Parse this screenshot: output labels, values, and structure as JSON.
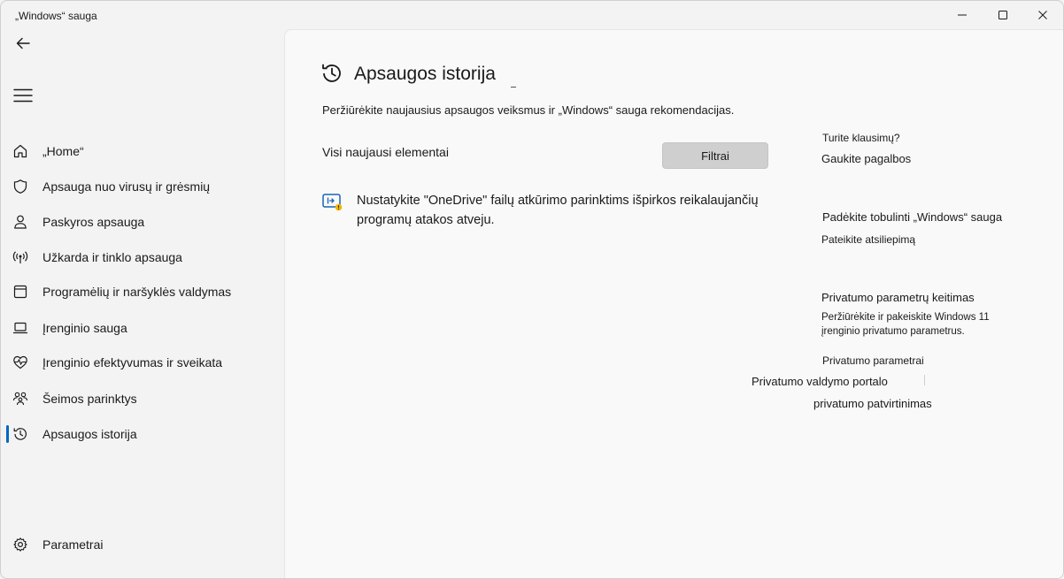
{
  "window": {
    "title": "„Windows“ sauga"
  },
  "sidebar": {
    "items": [
      {
        "label": "„Home“",
        "icon": "home-icon"
      },
      {
        "label": "Apsauga nuo virusų ir grėsmių",
        "icon": "shield-icon"
      },
      {
        "label": "Paskyros apsauga",
        "icon": "person-icon"
      },
      {
        "label": "Užkarda ir tinklo apsauga",
        "icon": "antenna-icon"
      },
      {
        "label": "Programėlių ir naršyklės valdymas",
        "icon": "app-window-icon"
      },
      {
        "label": "Įrenginio sauga",
        "icon": "laptop-icon"
      },
      {
        "label": "Įrenginio efektyvumas ir sveikata",
        "icon": "heart-pulse-icon"
      },
      {
        "label": "Šeimos parinktys",
        "icon": "family-icon"
      },
      {
        "label": "Apsaugos istorija",
        "icon": "history-icon",
        "active": true
      }
    ],
    "settings": {
      "label": "Parametrai",
      "icon": "gear-icon"
    }
  },
  "main": {
    "title": "Apsaugos istorija",
    "description": "Peržiūrėkite naujausius apsaugos veiksmus ir „Windows“ sauga rekomendacijas.",
    "recent_label": "Visi naujausi elementai",
    "filter_label": "Filtrai",
    "recommendation": "Nustatykite \"OneDrive\" failų atkūrimo parinktims išpirkos reikalaujančių programų atakos atveju."
  },
  "side_panel": {
    "questions_title": "Turite klausimų?",
    "help_link": "Gaukite pagalbos",
    "improve_title": "Padėkite tobulinti „Windows“ sauga",
    "feedback_link": "Pateikite atsiliepimą",
    "privacy_title": "Privatumo parametrų keitimas",
    "privacy_desc": "Peržiūrėkite ir pakeiskite Windows 11 įrenginio privatumo parametrus.",
    "privacy_settings_link": "Privatumo parametrai",
    "privacy_portal_link": "Privatumo valdymo portalo",
    "privacy_statement_link": "privatumo patvirtinimas"
  },
  "colors": {
    "accent": "#0067c0",
    "icon_blue": "#1a64b4",
    "badge_yellow": "#f2b600"
  }
}
